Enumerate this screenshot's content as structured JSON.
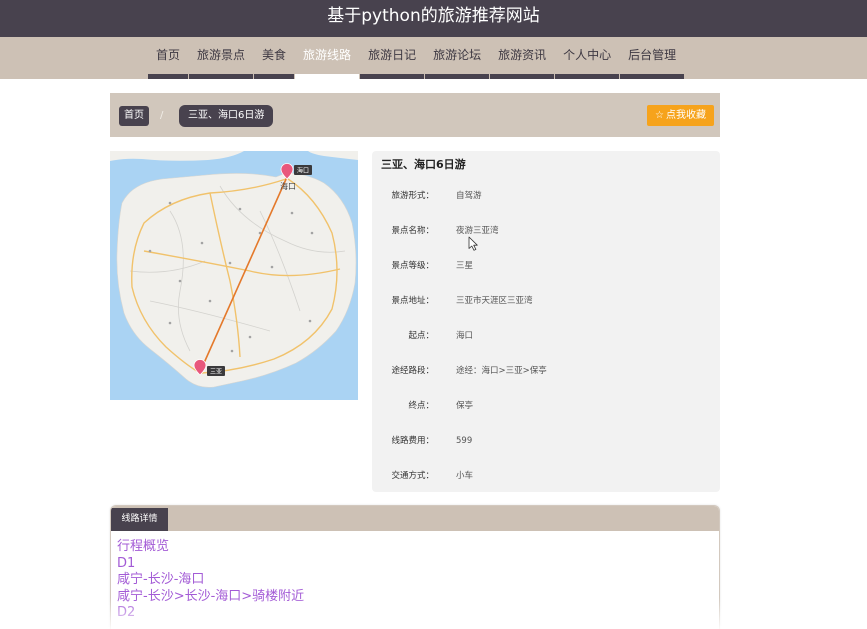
{
  "site": {
    "title": "基于python的旅游推荐网站"
  },
  "nav": {
    "items": [
      {
        "label": "首页"
      },
      {
        "label": "旅游景点"
      },
      {
        "label": "美食"
      },
      {
        "label": "旅游线路",
        "active": true
      },
      {
        "label": "旅游日记"
      },
      {
        "label": "旅游论坛"
      },
      {
        "label": "旅游资讯"
      },
      {
        "label": "个人中心"
      },
      {
        "label": "后台管理"
      }
    ]
  },
  "breadcrumb": {
    "home": "首页",
    "separator": "/",
    "current": "三亚、海口6日游"
  },
  "favorite_button": {
    "icon": "star-outline-icon",
    "label": "点我收藏"
  },
  "map": {
    "city_label": "海口",
    "markers": [
      {
        "label": "海口",
        "icon": "map-pin-icon"
      },
      {
        "label": "三亚",
        "icon": "map-pin-icon"
      }
    ]
  },
  "detail": {
    "title": "三亚、海口6日游",
    "fields": [
      {
        "label": "旅游形式：",
        "value": "自驾游"
      },
      {
        "label": "景点名称：",
        "value": "夜游三亚湾"
      },
      {
        "label": "景点等级：",
        "value": "三星"
      },
      {
        "label": "景点地址：",
        "value": "三亚市天涯区三亚湾"
      },
      {
        "label": "起点：",
        "value": "海口"
      },
      {
        "label": "途经路段：",
        "value": "途经：海口>三亚>保亭"
      },
      {
        "label": "终点：",
        "value": "保亭"
      },
      {
        "label": "线路费用：",
        "value": "599"
      },
      {
        "label": "交通方式：",
        "value": "小车"
      }
    ]
  },
  "tabs": [
    {
      "label": "线路详情",
      "active": true
    }
  ],
  "route_detail": {
    "lines": [
      "行程概览",
      "D1",
      "咸宁-长沙-海口",
      "咸宁-长沙>长沙-海口>骑楼附近",
      "D2"
    ]
  },
  "colors": {
    "header_bg": "#48424e",
    "nav_bg": "#cdc1b5",
    "nav_text": "#3e3943",
    "dark": "#48424e",
    "crumb_bg": "#d1c7bc",
    "favorite_bg": "#f6a31c",
    "panel_bg": "#f2f2f2",
    "route_text": "#a35bd6",
    "map_water": "#aad3f3",
    "map_land": "#f1f0ec",
    "route_line": "#e4792b",
    "marker": "#e8577c"
  }
}
